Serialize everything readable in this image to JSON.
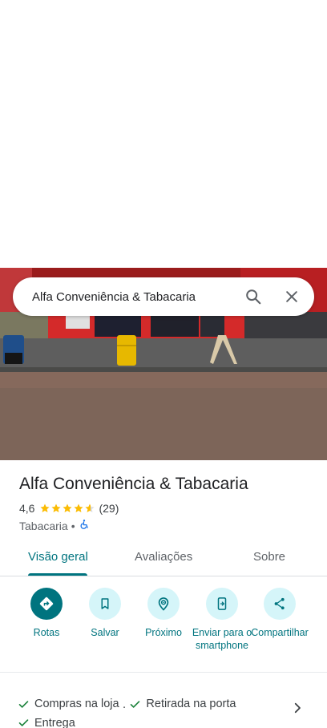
{
  "search": {
    "query": "Alfa Conveniência & Tabacaria"
  },
  "place": {
    "name": "Alfa Conveniência & Tabacaria",
    "rating": "4,6",
    "rating_value": 4.6,
    "review_count": "(29)",
    "category": "Tabacaria",
    "separator": "•"
  },
  "tabs": [
    {
      "label": "Visão geral",
      "active": true
    },
    {
      "label": "Avaliações",
      "active": false
    },
    {
      "label": "Sobre",
      "active": false
    }
  ],
  "actions": [
    {
      "label": "Rotas",
      "icon": "directions-icon"
    },
    {
      "label": "Salvar",
      "icon": "bookmark-icon"
    },
    {
      "label": "Próximo",
      "icon": "nearby-icon"
    },
    {
      "label": "Enviar para o smartphone",
      "icon": "send-to-phone-icon"
    },
    {
      "label": "Compartilhar",
      "icon": "share-icon"
    }
  ],
  "services": [
    {
      "label": "Compras na loja"
    },
    {
      "label": "Retirada na porta"
    },
    {
      "label": "Entrega"
    }
  ],
  "services_separator": "·",
  "colors": {
    "accent": "#00747f",
    "accent_light": "#d5f5f9",
    "star": "#fbbc04",
    "check": "#188038",
    "accessible": "#1a73e8"
  }
}
